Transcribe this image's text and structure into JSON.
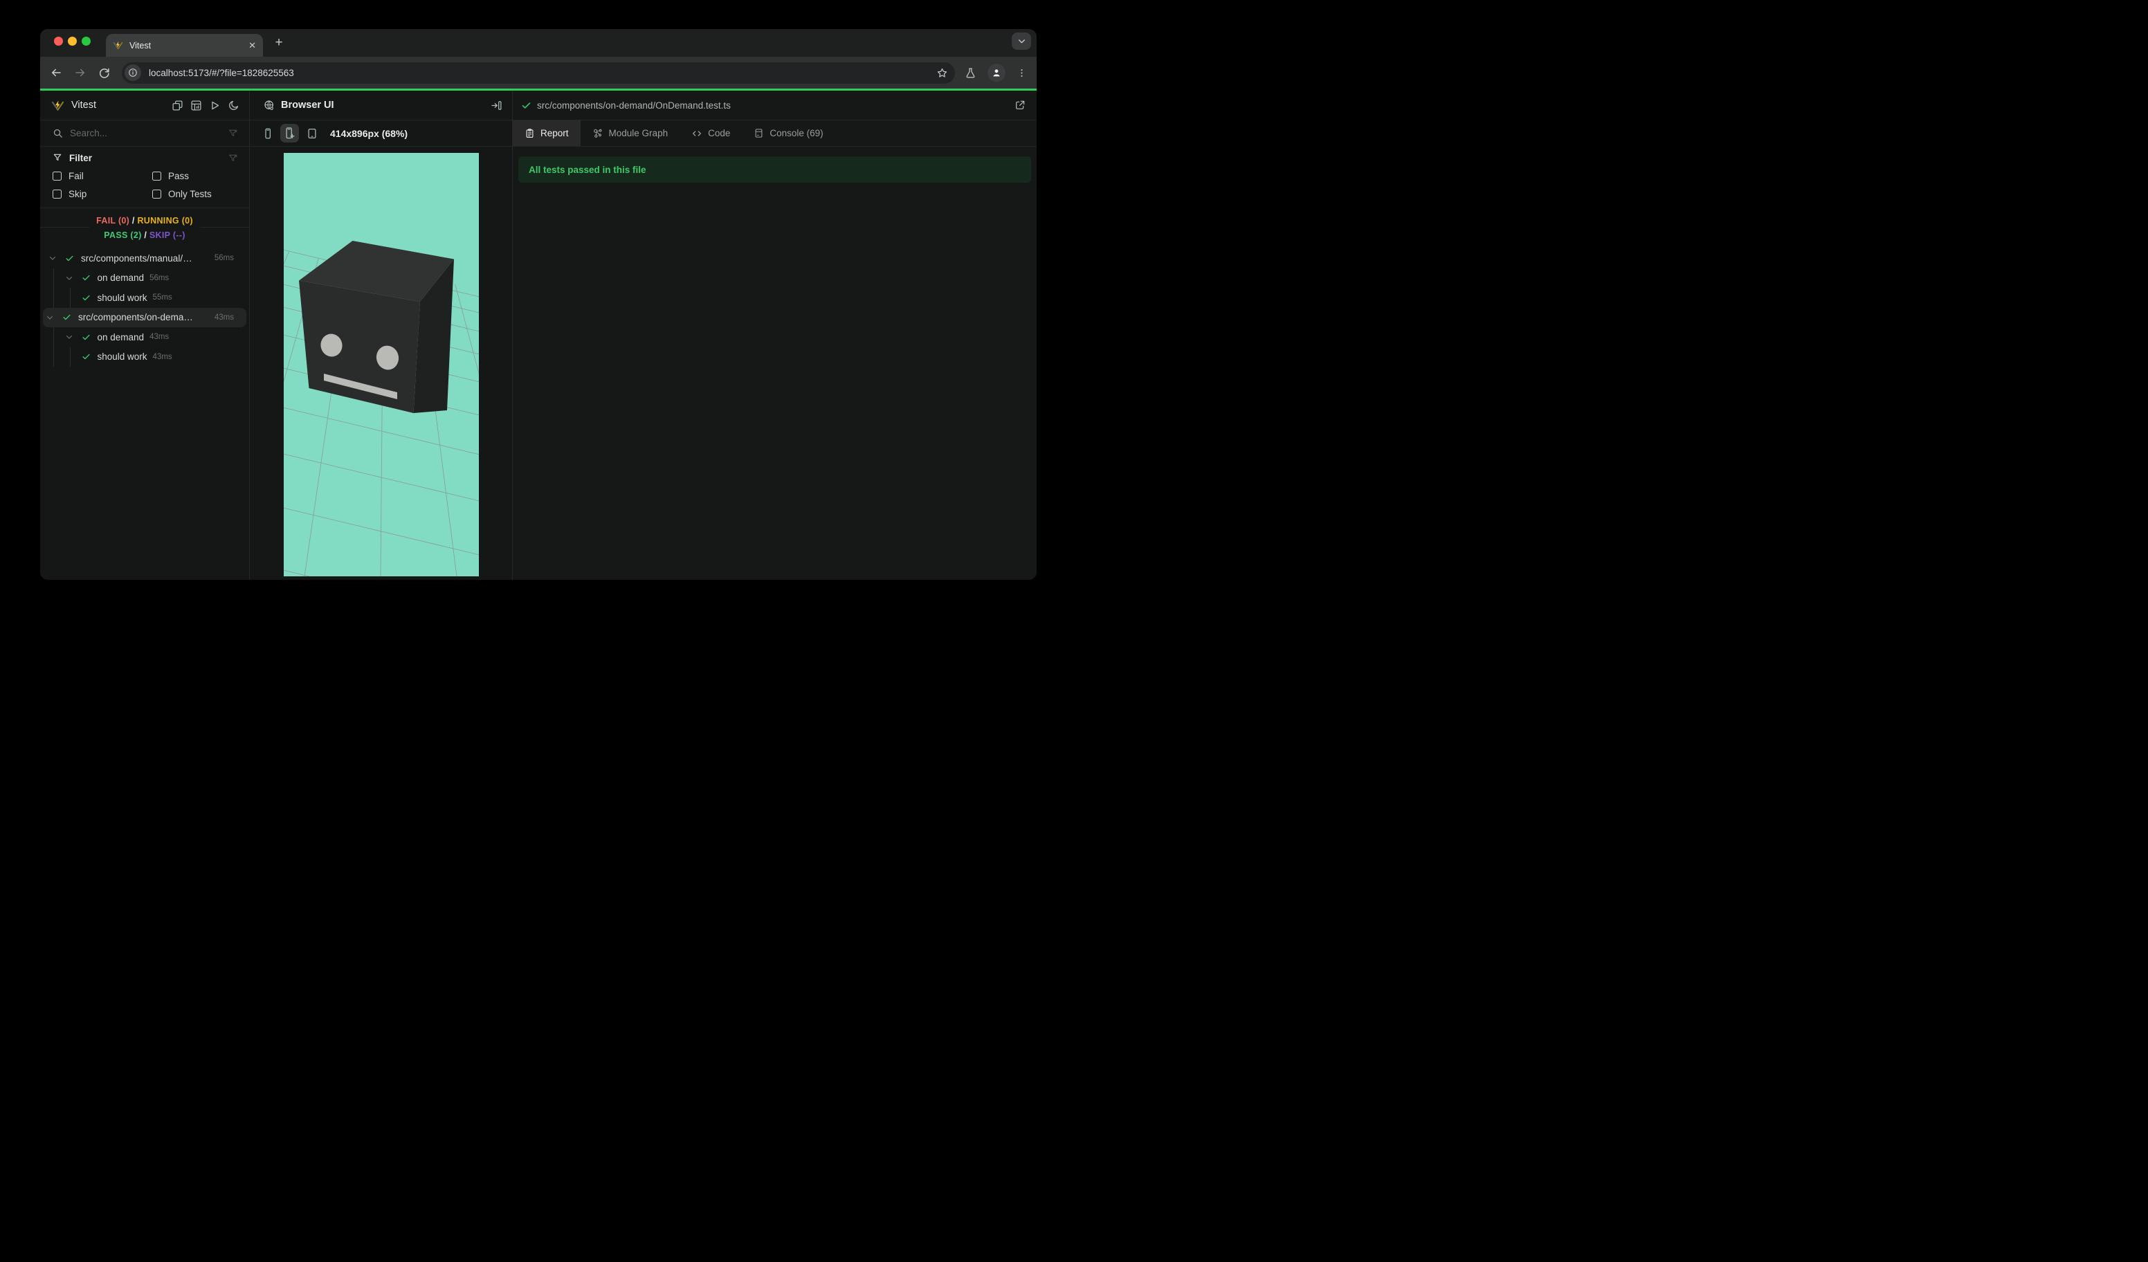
{
  "browser": {
    "tab_title": "Vitest",
    "close_glyph": "✕",
    "new_tab_glyph": "+",
    "url": "localhost:5173/#/?file=1828625563"
  },
  "sidebar": {
    "app_title": "Vitest",
    "search_placeholder": "Search...",
    "filter": {
      "title": "Filter",
      "options": [
        "Fail",
        "Pass",
        "Skip",
        "Only Tests"
      ]
    },
    "stats": {
      "fail": "FAIL (0)",
      "running": "RUNNING (0)",
      "pass": "PASS (2)",
      "skip": "SKIP (--)",
      "separator": "/"
    },
    "tree": [
      {
        "label": "src/components/manual/…",
        "duration": "56ms"
      },
      {
        "label": "on demand",
        "duration": "56ms"
      },
      {
        "label": "should work",
        "duration": "55ms"
      },
      {
        "label": "src/components/on-dema…",
        "duration": "43ms"
      },
      {
        "label": "on demand",
        "duration": "43ms"
      },
      {
        "label": "should work",
        "duration": "43ms"
      }
    ]
  },
  "preview": {
    "title": "Browser UI",
    "dimensions": "414x896px (68%)"
  },
  "report": {
    "file_path": "src/components/on-demand/OnDemand.test.ts",
    "tabs": [
      {
        "label": "Report"
      },
      {
        "label": "Module Graph"
      },
      {
        "label": "Code"
      },
      {
        "label": "Console (69)"
      }
    ],
    "banner": "All tests passed in this file"
  },
  "colors": {
    "pass_green": "#3ac569",
    "banner_text": "#40c867",
    "banner_bg": "#16291d",
    "fail_red": "#ec6a5e",
    "running_amber": "#e8b31c",
    "skip_purple": "#7e55cf",
    "progress_green": "#2ecd5c",
    "traffic_red": "#ff5f57",
    "traffic_yellow": "#febc2e",
    "traffic_green": "#28c840"
  },
  "scene": {
    "background": "#82dcc3",
    "grid_line": "#8a8a8a",
    "cube_top": "#303332",
    "cube_front": "#2a2c2b",
    "cube_right": "#1f2120",
    "face_features": "#b9bab6"
  }
}
